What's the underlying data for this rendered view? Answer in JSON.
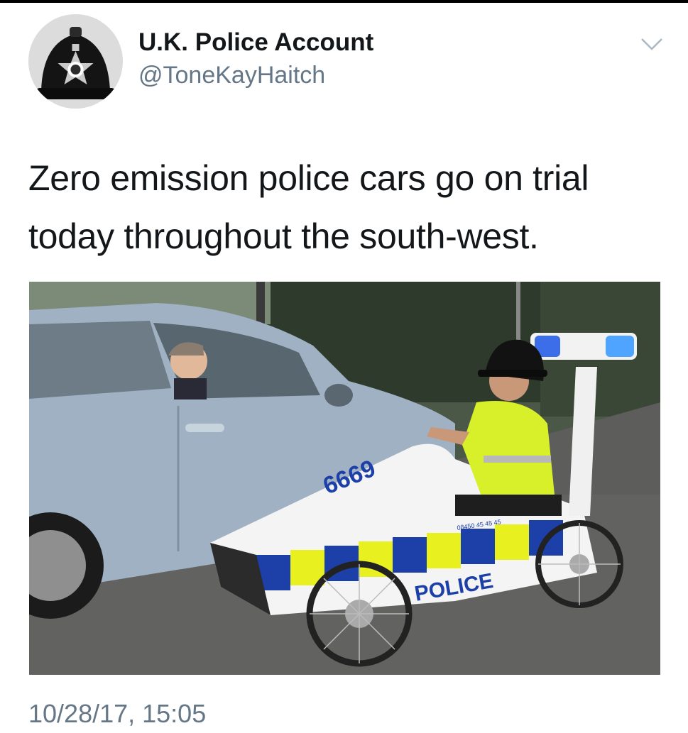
{
  "tweet": {
    "author": {
      "display_name": "U.K. Police Account",
      "handle": "@ToneKayHaitch",
      "avatar_icon": "police-helmet-avatar"
    },
    "menu_icon": "chevron-down-icon",
    "text": "Zero emission police cars go on trial today throughout the south-west.",
    "media": {
      "kind": "photo",
      "vehicle_markings": {
        "number": "6669",
        "label": "POLICE",
        "phone": "08450 45 45 45"
      }
    },
    "timestamp": "10/28/17, 15:05"
  },
  "colors": {
    "text_primary": "#14171a",
    "text_secondary": "#657786",
    "livery_blue": "#1c3fa8",
    "livery_yellow": "#e8f020"
  }
}
